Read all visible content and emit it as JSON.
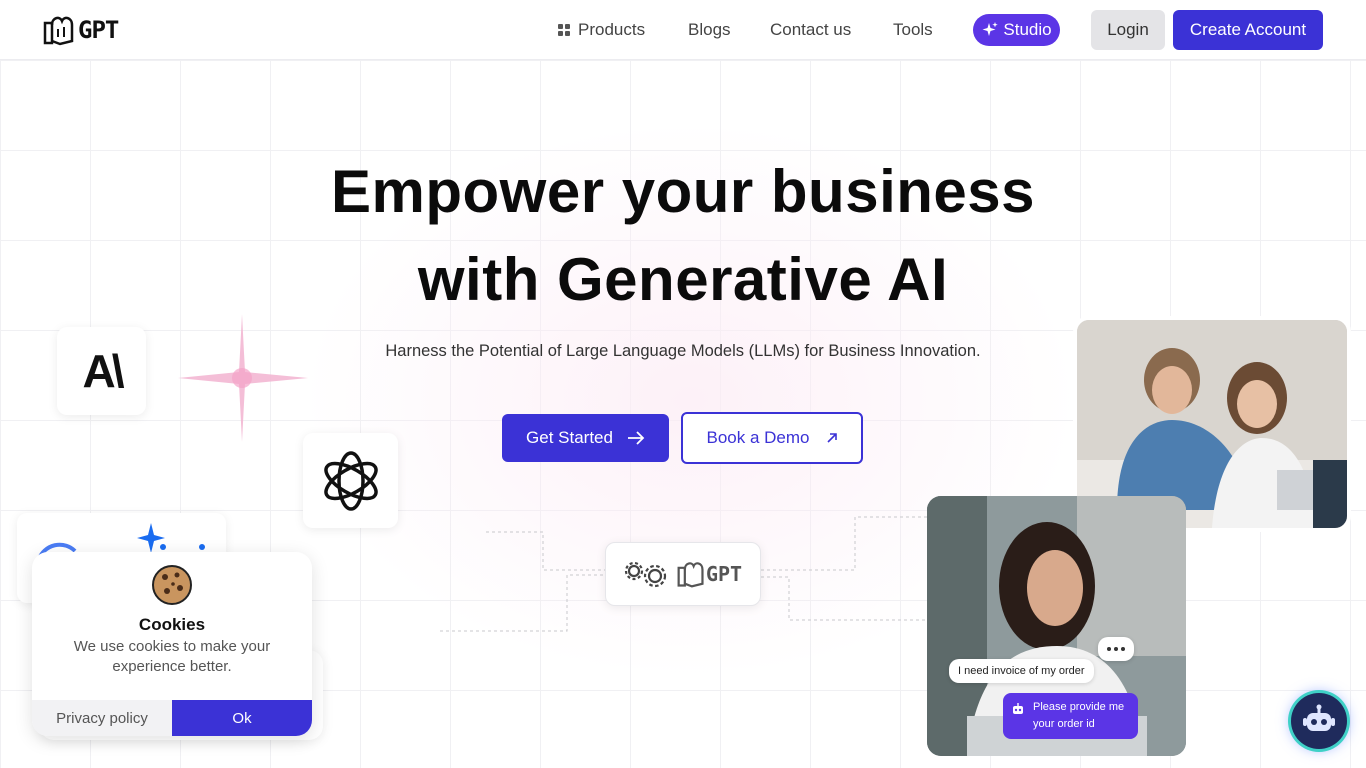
{
  "header": {
    "logo_text": "GPT",
    "nav": {
      "products": "Products",
      "blogs": "Blogs",
      "contact": "Contact us",
      "tools": "Tools"
    },
    "studio_label": "Studio",
    "login_label": "Login",
    "create_account_label": "Create Account"
  },
  "hero": {
    "title_line1": "Empower your business",
    "title_line2": "with Generative AI",
    "subtitle": "Harness the Potential of Large Language Models (LLMs) for Business Innovation.",
    "get_started_label": "Get Started",
    "book_demo_label": "Book a Demo"
  },
  "cards": {
    "anthropic_text": "A\\",
    "connector_logo_text": "GPT"
  },
  "chat_demo": {
    "user_message": "I need invoice of my order",
    "bot_message_line1": "Please provide me",
    "bot_message_line2": "your order id"
  },
  "cookie_banner": {
    "title": "Cookies",
    "text": "We use cookies to make your experience better.",
    "privacy_label": "Privacy policy",
    "ok_label": "Ok"
  },
  "colors": {
    "primary": "#3b32d6",
    "studio": "#5b35e6",
    "sparkle_pink": "#f2a6c8"
  },
  "icons": [
    "grid-icon",
    "sparkle-icon",
    "arrow-right-icon",
    "arrow-up-right-icon",
    "openai-icon",
    "gemini-icon",
    "gears-icon",
    "cookie-icon",
    "chatbot-icon"
  ]
}
